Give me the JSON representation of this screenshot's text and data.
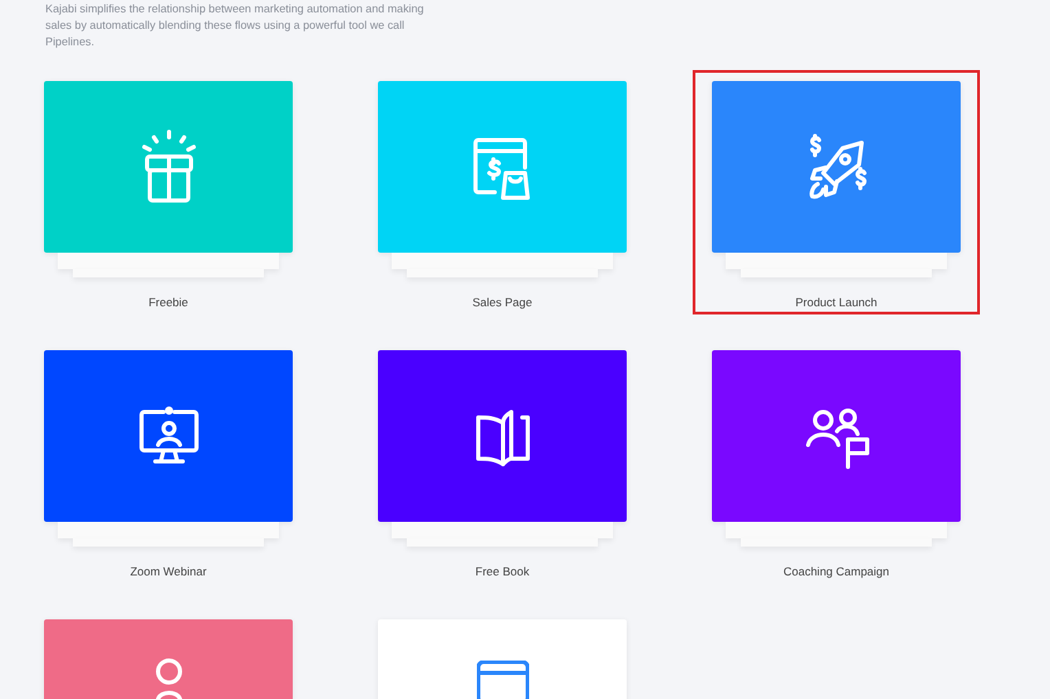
{
  "intro": "Kajabi simplifies the relationship between marketing automation and making sales by automatically blending these flows using a powerful tool we call Pipelines.",
  "templates": [
    {
      "label": "Freebie",
      "color": "#00d1c7",
      "selected": false
    },
    {
      "label": "Sales Page",
      "color": "#00d4f5",
      "selected": false
    },
    {
      "label": "Product Launch",
      "color": "#2a86fb",
      "selected": true
    },
    {
      "label": "Zoom Webinar",
      "color": "#0047ff",
      "selected": false
    },
    {
      "label": "Free Book",
      "color": "#4a00ff",
      "selected": false
    },
    {
      "label": "Coaching Campaign",
      "color": "#7a08ff",
      "selected": false
    },
    {
      "color": "#ef6b87",
      "selected": false
    },
    {
      "color": "#ffffff",
      "selected": false
    }
  ]
}
